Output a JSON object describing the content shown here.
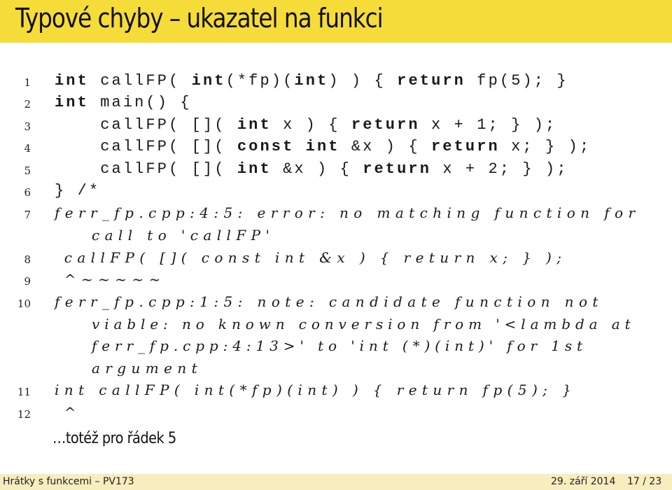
{
  "slide": {
    "title": "Typové chyby – ukazatel na funkci",
    "footnote": "…totéž pro řádek 5",
    "footer": {
      "left": "Hrátky s funkcemi – PV173",
      "date": "29. září 2014",
      "page": "17 / 23"
    }
  },
  "code_lines": [
    {
      "num": "1",
      "parts": [
        {
          "t": "int",
          "b": true
        },
        {
          "t": " callFP( "
        },
        {
          "t": "int",
          "b": true
        },
        {
          "t": "(*fp)("
        },
        {
          "t": "int",
          "b": true
        },
        {
          "t": ") ) { "
        },
        {
          "t": "return",
          "b": true
        },
        {
          "t": " fp(5); }"
        }
      ]
    },
    {
      "num": "2",
      "parts": [
        {
          "t": "int",
          "b": true
        },
        {
          "t": " main() {"
        }
      ]
    },
    {
      "num": "3",
      "parts": [
        {
          "t": "    callFP( []( "
        },
        {
          "t": "int",
          "b": true
        },
        {
          "t": " x ) { "
        },
        {
          "t": "return",
          "b": true
        },
        {
          "t": " x + 1; } );"
        }
      ]
    },
    {
      "num": "4",
      "parts": [
        {
          "t": "    callFP( []( "
        },
        {
          "t": "const int",
          "b": true
        },
        {
          "t": " &x ) { "
        },
        {
          "t": "return",
          "b": true
        },
        {
          "t": " x; } );"
        }
      ]
    },
    {
      "num": "5",
      "parts": [
        {
          "t": "    callFP( []( "
        },
        {
          "t": "int",
          "b": true
        },
        {
          "t": " &x ) { "
        },
        {
          "t": "return",
          "b": true
        },
        {
          "t": " x + 2; } );"
        }
      ]
    },
    {
      "num": "6",
      "parts": [
        {
          "t": "} /*"
        }
      ]
    }
  ],
  "comment_lines": [
    {
      "num": "7",
      "text": "ferr_fp.cpp:4:5: error: no matching function for"
    },
    {
      "num": "",
      "text": "call to 'callFP'",
      "cont": true
    },
    {
      "num": "8",
      "text": " callFP( []( const int &x ) { return x; } );"
    },
    {
      "num": "9",
      "text": " ^~~~~~"
    },
    {
      "num": "10",
      "text": "ferr_fp.cpp:1:5: note: candidate function not"
    },
    {
      "num": "",
      "text": "viable: no known conversion from '<lambda at",
      "cont": true
    },
    {
      "num": "",
      "text": "ferr_fp.cpp:4:13>' to 'int (*)(int)' for 1st",
      "cont": true
    },
    {
      "num": "",
      "text": "argument",
      "cont": true
    },
    {
      "num": "11",
      "text": "int callFP( int(*fp)(int) ) { return fp(5); }"
    },
    {
      "num": "12",
      "text": " ^"
    }
  ]
}
